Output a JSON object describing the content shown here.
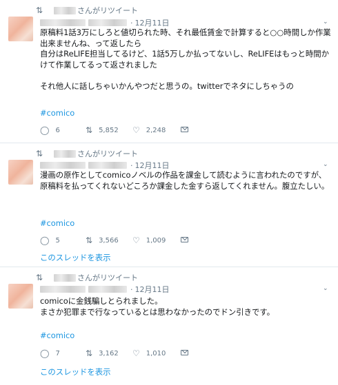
{
  "tweets": [
    {
      "retweet_label": "さんがリツイート",
      "date": "12月11日",
      "text": "原稿料1話3万にしろと値切られた時、それ最低賃金で計算すると○○時間しか作業出来ませんね、って返したら\n自分はReLIFE担当してるけど、1話5万しか払ってないし、ReLIFEはもっと時間かけて作業してるって返されました\n\nそれ他人に話しちゃいかんやつだと思うの。twitterでネタにしちゃうの",
      "hashtag": "#comico",
      "replies": "6",
      "retweets": "5,852",
      "likes": "2,248",
      "thread_link": ""
    },
    {
      "retweet_label": "さんがリツイート",
      "date": "12月11日",
      "text": "漫画の原作としてcomicoノベルの作品を課金して読むように言われたのですが、原稿料を払ってくれないどころか課金した金すら返してくれません。腹立たしい。",
      "hashtag": "#comico",
      "replies": "5",
      "retweets": "3,566",
      "likes": "1,009",
      "thread_link": "このスレッドを表示"
    },
    {
      "retweet_label": "さんがリツイート",
      "date": "12月11日",
      "text": "comicoに金銭騙しとられました。\nまさか犯罪まで行なっているとは思わなかったのでドン引きです。",
      "hashtag": "#comico",
      "replies": "7",
      "retweets": "3,162",
      "likes": "1,010",
      "thread_link": "このスレッドを表示"
    }
  ],
  "icons": {
    "retweet": "retweet-icon",
    "reply": "reply-icon",
    "like": "heart-icon",
    "dm": "envelope-icon",
    "more": "chevron-down-icon"
  },
  "colors": {
    "link": "#1b95e0",
    "meta": "#657786",
    "text": "#14171a",
    "divider": "#e1e8ed"
  }
}
